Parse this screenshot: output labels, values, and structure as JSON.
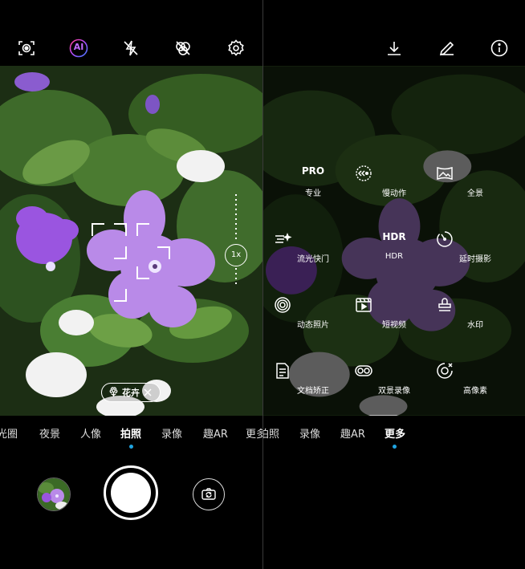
{
  "left": {
    "top_icons": [
      "scan-icon",
      "ai-icon",
      "flash-off-icon",
      "filter-off-icon",
      "settings-icon"
    ],
    "ai_label": "AI",
    "scene_chip": {
      "label": "花卉",
      "icon": "flower-icon",
      "close_icon": "close-icon"
    },
    "zoom_label": "1x",
    "modes": [
      "光圈",
      "夜景",
      "人像",
      "拍照",
      "录像",
      "趣AR",
      "更多"
    ],
    "active_mode": "拍照",
    "accent_color": "#1fa3e0"
  },
  "right": {
    "top_icons": [
      "download-icon",
      "edit-icon",
      "info-icon"
    ],
    "grid": [
      {
        "icon_text": "PRO",
        "label": "专业"
      },
      {
        "icon": "slow-motion-icon",
        "label": "慢动作"
      },
      {
        "icon": "panorama-icon",
        "label": "全景"
      },
      {
        "icon": "light-painting-icon",
        "label": "流光快门"
      },
      {
        "icon_text": "HDR",
        "label": "HDR"
      },
      {
        "icon": "timelapse-icon",
        "label": "延时摄影"
      },
      {
        "icon": "moving-picture-icon",
        "label": "动态照片"
      },
      {
        "icon": "short-video-icon",
        "label": "短视频"
      },
      {
        "icon": "watermark-icon",
        "label": "水印"
      },
      {
        "icon": "document-icon",
        "label": "文档矫正"
      },
      {
        "icon": "dual-view-icon",
        "label": "双景录像"
      },
      {
        "icon": "high-res-icon",
        "label": "高像素"
      }
    ],
    "modes": [
      "拍照",
      "录像",
      "趣AR",
      "更多"
    ],
    "active_mode": "更多",
    "accent_color": "#1fa3e0"
  }
}
